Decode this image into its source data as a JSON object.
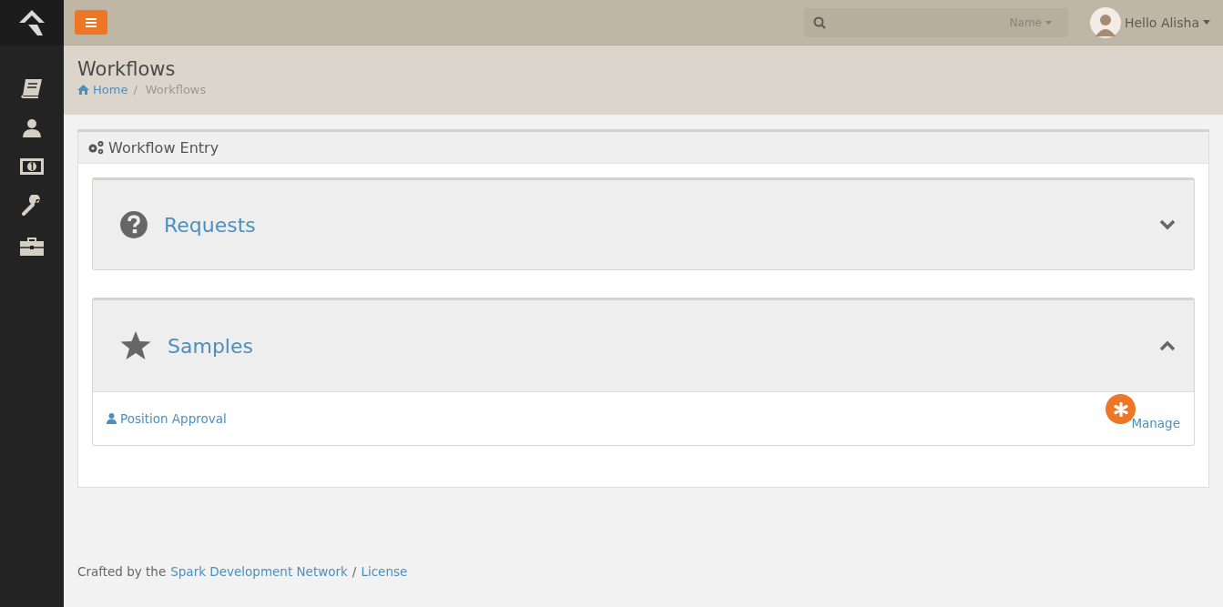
{
  "header": {
    "search": {
      "filter": "Name"
    },
    "user": {
      "greeting": "Hello Alisha"
    }
  },
  "page": {
    "title": "Workflows",
    "breadcrumbs": [
      {
        "label": "Home",
        "link": true
      },
      {
        "label": "Workflows",
        "link": false
      }
    ],
    "breadcrumb_separator": "/"
  },
  "panel": {
    "title": "Workflow Entry",
    "categories": [
      {
        "name": "Requests",
        "expanded": false
      },
      {
        "name": "Samples",
        "expanded": true,
        "items": [
          {
            "label": "Position Approval"
          }
        ],
        "action": "Manage"
      }
    ]
  },
  "footer": {
    "prefix": "Crafted by the",
    "link": "Spark Development Network",
    "separator": "/",
    "license": "License"
  }
}
